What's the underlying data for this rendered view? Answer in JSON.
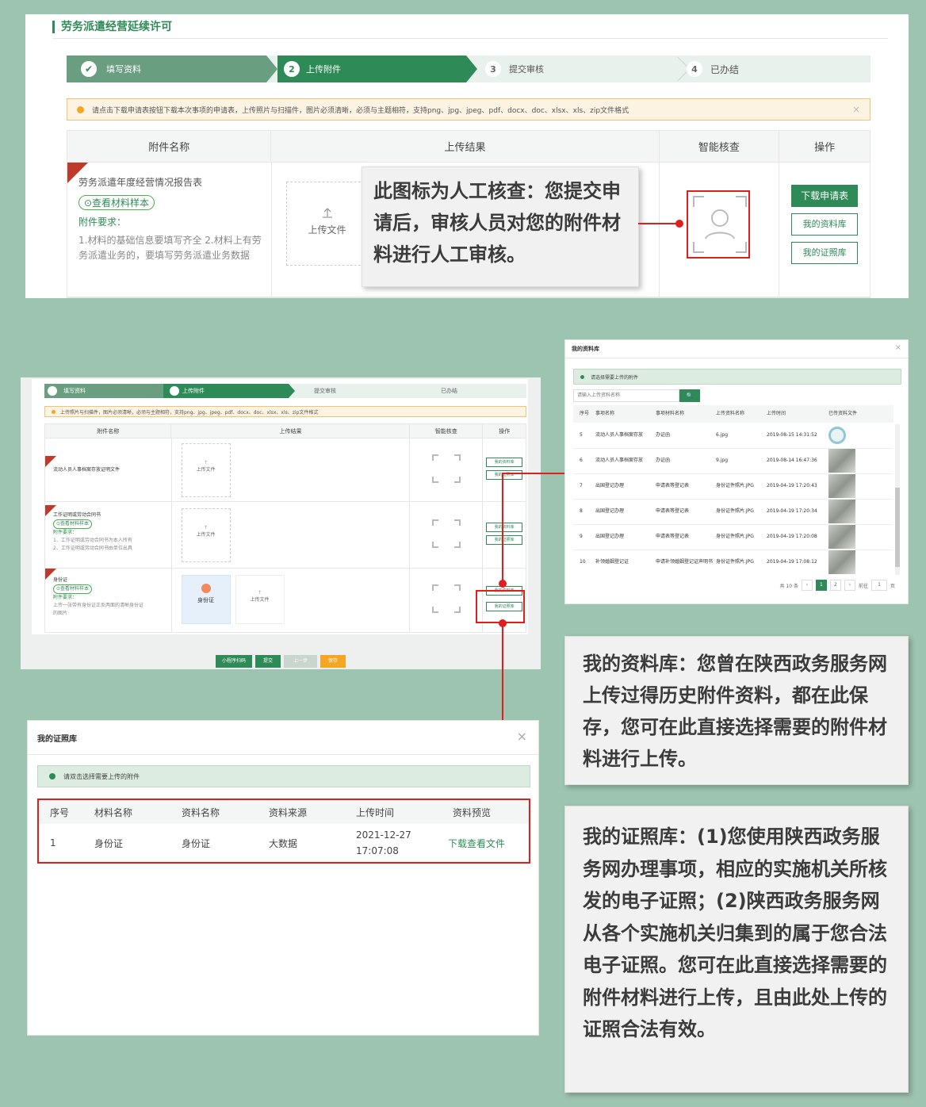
{
  "panel1": {
    "title": "劳务派遣经营延续许可",
    "steps": [
      {
        "num": "✔",
        "label": "填写资料"
      },
      {
        "num": "2",
        "label": "上传附件"
      },
      {
        "num": "3",
        "label": "提交审核"
      },
      {
        "num": "4",
        "label": "已办结"
      }
    ],
    "notice": "请点击下载申请表按钮下载本次事项的申请表，上传照片与扫描件，图片必须清晰，必须与主题相符，支持png、jpg、jpeg、pdf、docx、doc、xlsx、xls、zip文件格式",
    "headers": {
      "name": "附件名称",
      "result": "上传结果",
      "check": "智能核查",
      "op": "操作"
    },
    "row": {
      "corner": "必传",
      "name": "劳务派遣年度经营情况报告表",
      "sample": "⊙查看材料样本",
      "req_label": "附件要求：",
      "req_text": "1.材料的基础信息要填写齐全 2.材料上有劳务派遣业务的，要填写劳务派遣业务数据",
      "upload": "上传文件",
      "btn_download": "下载申请表",
      "btn_lib": "我的资料库",
      "btn_cert": "我的证照库"
    },
    "callout": "此图标为人工核查：您提交申请后，审核人员对您的附件材料进行人工审核。"
  },
  "panel2": {
    "steps": [
      "填写资料",
      "上传附件",
      "提交审核",
      "已办结"
    ],
    "notice": "上传照片与扫描件，图片必须清晰，必须与主题相符，支持png、jpg、jpeg、pdf、docx、doc、xlsx、xls、zip文件格式",
    "headers": {
      "name": "附件名称",
      "result": "上传结果",
      "check": "智能核查",
      "op": "操作"
    },
    "rows": [
      {
        "name": "流动人员人事档案存放证明文件",
        "extra": ""
      },
      {
        "name": "工作证明或劳动合同书",
        "extra": "⊙查看材料样本",
        "req": "附件要求：",
        "req1": "1、工作证明或劳动合同书为本人所有",
        "req2": "2、工作证明或劳动合同书由单位出具"
      },
      {
        "name": "身份证",
        "extra": "⊙查看材料样本",
        "req": "附件要求：",
        "req1": "上传一张带有身份证正反两面的清晰身份证",
        "req2": "的图片",
        "file": "身份证"
      }
    ],
    "upload": "上传文件",
    "btn_lib": "我的资料库",
    "btn_cert": "我的证照库",
    "bottom_buttons": [
      "小程序扫码",
      "提交",
      "上一步",
      "保存"
    ]
  },
  "lib_modal": {
    "title": "我的资料库",
    "tip": "请选择需要上传的附件",
    "search_placeholder": "请输入上传资料名称",
    "search_btn": "🔍",
    "cols": [
      "序号",
      "事项名称",
      "事项材料名称",
      "上传资料名称",
      "上传时间",
      "已传资料文件"
    ],
    "rows": [
      {
        "no": "5",
        "item": "流动人员人事档案存放",
        "mat": "办证函",
        "file": "6.jpg",
        "time": "2019-08-15 14:31:52"
      },
      {
        "no": "6",
        "item": "流动人员人事档案存放",
        "mat": "办证函",
        "file": "9.jpg",
        "time": "2019-08-14 16:47:36"
      },
      {
        "no": "7",
        "item": "出国登记办理",
        "mat": "申请表等登记表",
        "file": "身份证件照片.JPG",
        "time": "2019-04-19 17:20:43"
      },
      {
        "no": "8",
        "item": "出国登记办理",
        "mat": "申请表等登记表",
        "file": "身份证件照片.JPG",
        "time": "2019-04-19 17:20:34"
      },
      {
        "no": "9",
        "item": "出国登记办理",
        "mat": "申请表等登记表",
        "file": "身份证件照片.JPG",
        "time": "2019-04-19 17:20:08"
      },
      {
        "no": "10",
        "item": "补领婚姻登记证",
        "mat": "申请补领婚姻登记证声明书",
        "file": "身份证件照片.JPG",
        "time": "2019-04-19 17:08:12"
      }
    ],
    "pager": {
      "total": "共 10 条",
      "p1": "1",
      "p2": "2",
      "goto": "前往",
      "page": "1",
      "unit": "页"
    }
  },
  "cert_modal": {
    "title": "我的证照库",
    "tip": "请双击选择需要上传的附件",
    "cols": [
      "序号",
      "材料名称",
      "资料名称",
      "资料来源",
      "上传时间",
      "资料预览"
    ],
    "row": {
      "no": "1",
      "mat": "身份证",
      "name": "身份证",
      "source": "大数据",
      "time": "2021-12-27 17:07:08",
      "preview": "下载查看文件"
    }
  },
  "callout_lib": "我的资料库：您曾在陕西政务服务网上传过得历史附件资料，都在此保存，您可在此直接选择需要的附件材料进行上传。",
  "callout_cert": "我的证照库：(1)您使用陕西政务服务网办理事项，相应的实施机关所核发的电子证照；(2)陕西政务服务网从各个实施机关归集到的属于您合法电子证照。您可在此直接选择需要的附件材料进行上传，且由此处上传的证照合法有效。",
  "colors": {
    "primary": "#2e8b57",
    "background": "#9dc4b0",
    "highlight": "#e01e1e",
    "warning": "#f5a623"
  },
  "icons": [
    "check-icon",
    "upload-icon",
    "face-scan-icon",
    "close-icon",
    "search-icon",
    "info-dot-icon"
  ]
}
